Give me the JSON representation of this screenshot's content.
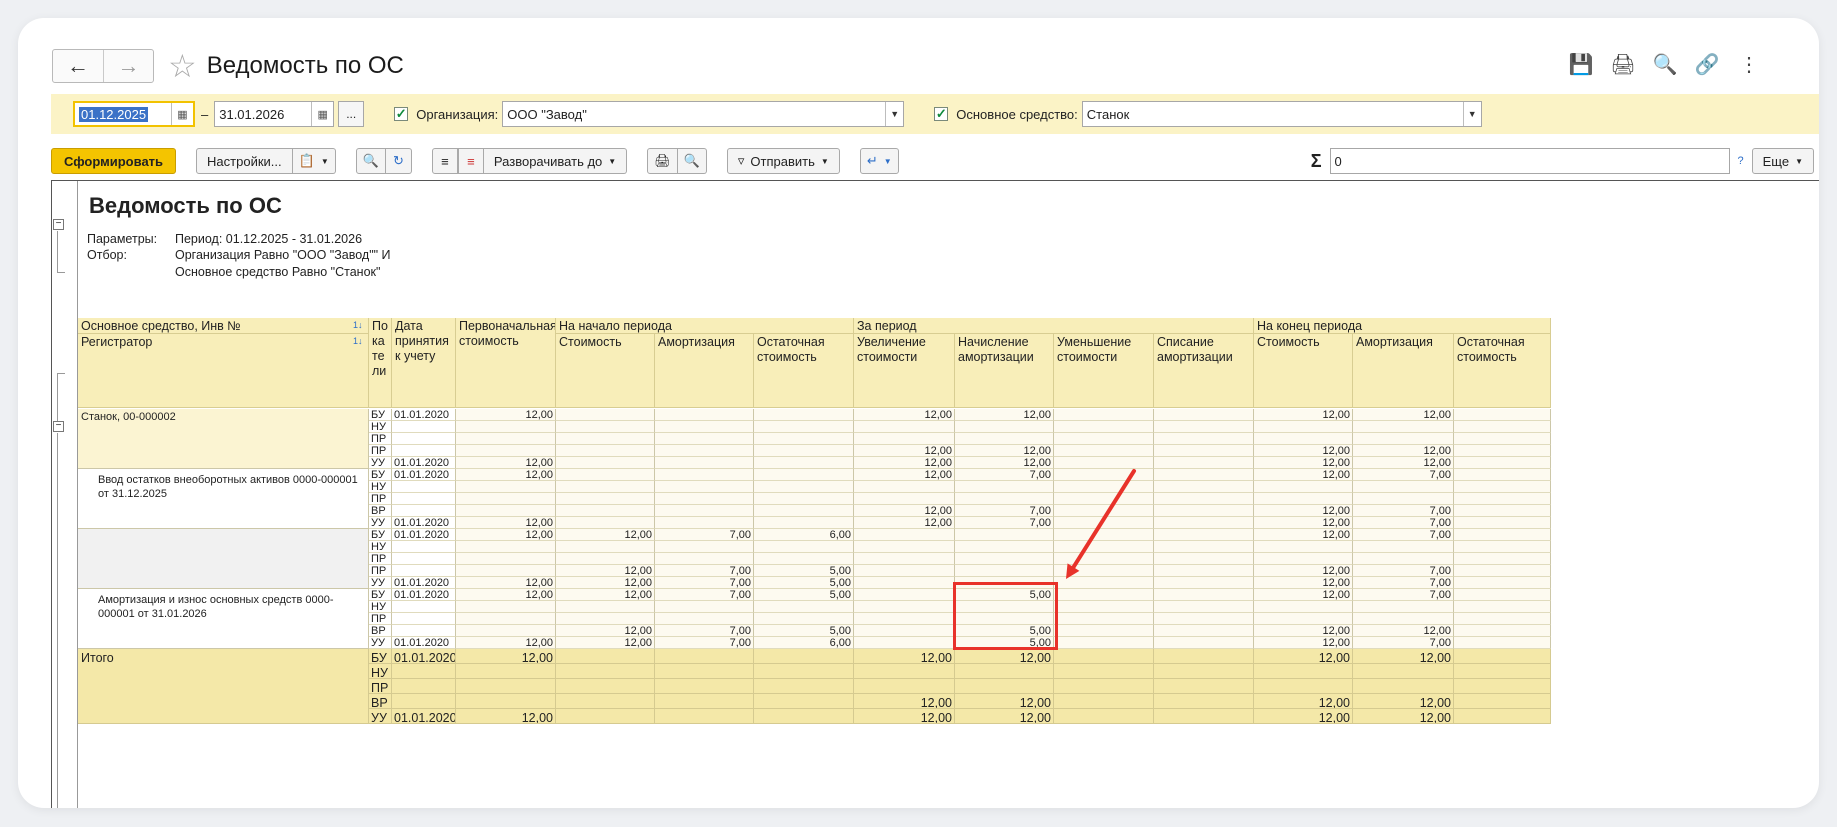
{
  "window": {
    "title": "Ведомость по ОС",
    "back_icon": "arrow-left-icon",
    "forward_icon": "arrow-right-icon",
    "favorite_icon": "star-icon",
    "header_icons": [
      "save-icon",
      "print-icon",
      "preview-icon",
      "link-icon",
      "more-icon"
    ]
  },
  "filters": {
    "date_from": "01.12.2025",
    "date_sep": "–",
    "date_to": "31.01.2026",
    "period_more": "...",
    "org_label": "Организация:",
    "org_value": "ООО \"Завод\"",
    "asset_label": "Основное средство:",
    "asset_value": "Станок"
  },
  "toolbar": {
    "generate": "Сформировать",
    "settings": "Настройки...",
    "expand": "Разворачивать до",
    "send": "Отправить",
    "sum_value": "0",
    "help": "?",
    "more": "Еще"
  },
  "report": {
    "title": "Ведомость по ОС",
    "params_label": "Параметры:",
    "params_value": "Период: 01.12.2025 - 31.01.2026",
    "filter_label": "Отбор:",
    "filter_line1": "Организация Равно \"ООО \"Завод\"\" И",
    "filter_line2": "Основное средство Равно \"Станок\"",
    "headers": {
      "asset": "Основное средство, Инв №",
      "registrar": "Регистратор",
      "indicator": "По ка те ли",
      "date": "Дата принятия к учету",
      "initial": "Первоначальная стоимость",
      "start_group": "На начало периода",
      "period_group": "За период",
      "end_group": "На конец периода",
      "cost": "Стоимость",
      "amort": "Амортизация",
      "residual": "Остаточная стоимость",
      "inc": "Увеличение стоимости",
      "accr": "Начисление амортизации",
      "dec": "Уменьшение стоимости",
      "writeoff": "Списание амортизации",
      "sort": "1↓"
    },
    "groups": [
      {
        "label": "Станок, 00-000002",
        "rows": [
          [
            "БУ",
            "01.01.2020",
            "12,00",
            "",
            "",
            "",
            "12,00",
            "12,00",
            "",
            "",
            "12,00",
            "12,00",
            ""
          ],
          [
            "НУ",
            "",
            "",
            "",
            "",
            "",
            "",
            "",
            "",
            "",
            "",
            "",
            ""
          ],
          [
            "ПР",
            "",
            "",
            "",
            "",
            "",
            "",
            "",
            "",
            "",
            "",
            "",
            ""
          ],
          [
            "ПР",
            "",
            "",
            "",
            "",
            "",
            "12,00",
            "12,00",
            "",
            "",
            "12,00",
            "12,00",
            ""
          ],
          [
            "УУ",
            "01.01.2020",
            "12,00",
            "",
            "",
            "",
            "12,00",
            "12,00",
            "",
            "",
            "12,00",
            "12,00",
            ""
          ]
        ]
      },
      {
        "label": "Ввод остатков внеоборотных активов 0000-000001 от 31.12.2025",
        "rows": [
          [
            "БУ",
            "01.01.2020",
            "12,00",
            "",
            "",
            "",
            "12,00",
            "7,00",
            "",
            "",
            "12,00",
            "7,00",
            ""
          ],
          [
            "НУ",
            "",
            "",
            "",
            "",
            "",
            "",
            "",
            "",
            "",
            "",
            "",
            ""
          ],
          [
            "ПР",
            "",
            "",
            "",
            "",
            "",
            "",
            "",
            "",
            "",
            "",
            "",
            ""
          ],
          [
            "ВР",
            "",
            "",
            "",
            "",
            "",
            "12,00",
            "7,00",
            "",
            "",
            "12,00",
            "7,00",
            ""
          ],
          [
            "УУ",
            "01.01.2020",
            "12,00",
            "",
            "",
            "",
            "12,00",
            "7,00",
            "",
            "",
            "12,00",
            "7,00",
            ""
          ]
        ]
      },
      {
        "label": "",
        "rows": [
          [
            "БУ",
            "01.01.2020",
            "12,00",
            "12,00",
            "7,00",
            "6,00",
            "",
            "",
            "",
            "",
            "12,00",
            "7,00",
            ""
          ],
          [
            "НУ",
            "",
            "",
            "",
            "",
            "",
            "",
            "",
            "",
            "",
            "",
            "",
            ""
          ],
          [
            "ПР",
            "",
            "",
            "",
            "",
            "",
            "",
            "",
            "",
            "",
            "",
            "",
            ""
          ],
          [
            "ПР",
            "",
            "",
            "12,00",
            "7,00",
            "5,00",
            "",
            "",
            "",
            "",
            "12,00",
            "7,00",
            ""
          ],
          [
            "УУ",
            "01.01.2020",
            "12,00",
            "12,00",
            "7,00",
            "5,00",
            "",
            "",
            "",
            "",
            "12,00",
            "7,00",
            ""
          ]
        ]
      },
      {
        "label": "Амортизация и износ основных средств 0000-000001 от 31.01.2026",
        "rows": [
          [
            "БУ",
            "01.01.2020",
            "12,00",
            "12,00",
            "7,00",
            "5,00",
            "",
            "5,00",
            "",
            "",
            "12,00",
            "7,00",
            ""
          ],
          [
            "НУ",
            "",
            "",
            "",
            "",
            "",
            "",
            "",
            "",
            "",
            "",
            "",
            ""
          ],
          [
            "ПР",
            "",
            "",
            "",
            "",
            "",
            "",
            "",
            "",
            "",
            "",
            "",
            ""
          ],
          [
            "ВР",
            "",
            "",
            "12,00",
            "7,00",
            "5,00",
            "",
            "5,00",
            "",
            "",
            "12,00",
            "12,00",
            ""
          ],
          [
            "УУ",
            "01.01.2020",
            "12,00",
            "12,00",
            "7,00",
            "6,00",
            "",
            "5,00",
            "",
            "",
            "12,00",
            "7,00",
            ""
          ]
        ]
      }
    ],
    "total": {
      "label": "Итого",
      "rows": [
        [
          "БУ",
          "01.01.2020",
          "12,00",
          "",
          "",
          "",
          "12,00",
          "12,00",
          "",
          "",
          "12,00",
          "12,00",
          ""
        ],
        [
          "НУ",
          "",
          "",
          "",
          "",
          "",
          "",
          "",
          "",
          "",
          "",
          "",
          ""
        ],
        [
          "ПР",
          "",
          "",
          "",
          "",
          "",
          "",
          "",
          "",
          "",
          "",
          "",
          ""
        ],
        [
          "ВР",
          "",
          "",
          "",
          "",
          "",
          "12,00",
          "12,00",
          "",
          "",
          "12,00",
          "12,00",
          ""
        ],
        [
          "УУ",
          "01.01.2020",
          "12,00",
          "",
          "",
          "",
          "12,00",
          "12,00",
          "",
          "",
          "12,00",
          "12,00",
          ""
        ]
      ]
    }
  },
  "colors": {
    "accent": "#f4c400",
    "header_bg": "#f8eeb9",
    "filter_bg": "#fbf3c6",
    "highlight": "#e8322a"
  }
}
